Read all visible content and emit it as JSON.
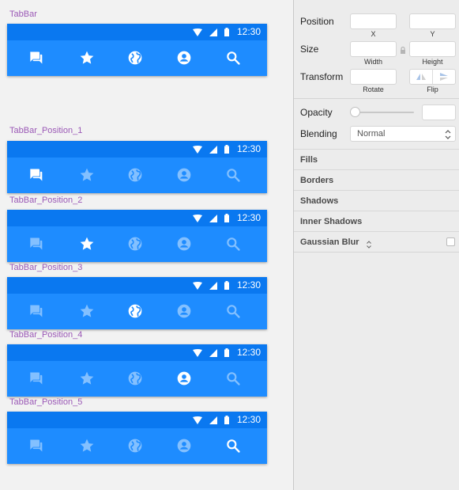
{
  "artboards": [
    {
      "label": "TabBar",
      "active_tab": -1
    },
    {
      "label": "TabBar_Position_1",
      "active_tab": 0
    },
    {
      "label": "TabBar_Position_2",
      "active_tab": 1
    },
    {
      "label": "TabBar_Position_3",
      "active_tab": 2
    },
    {
      "label": "TabBar_Position_4",
      "active_tab": 3
    },
    {
      "label": "TabBar_Position_5",
      "active_tab": 4
    }
  ],
  "status_bar": {
    "time": "12:30"
  },
  "tabs": [
    "chat-icon",
    "star-icon",
    "globe-icon",
    "account-icon",
    "search-icon"
  ],
  "colors": {
    "tabbar": "#1e8cff",
    "status": "#0a78f0",
    "label": "#9b59b6"
  },
  "inspector": {
    "position_label": "Position",
    "x_label": "X",
    "y_label": "Y",
    "size_label": "Size",
    "width_label": "Width",
    "height_label": "Height",
    "transform_label": "Transform",
    "rotate_label": "Rotate",
    "flip_label": "Flip",
    "opacity_label": "Opacity",
    "blending_label": "Blending",
    "blending_value": "Normal",
    "sections": [
      "Fills",
      "Borders",
      "Shadows",
      "Inner Shadows",
      "Gaussian Blur"
    ]
  }
}
